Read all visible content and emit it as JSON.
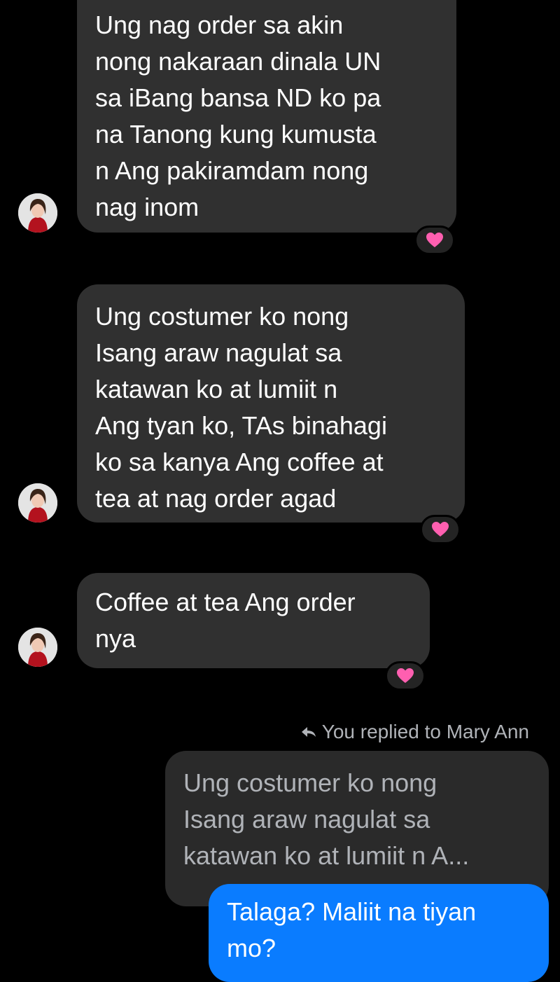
{
  "conversation": {
    "contact_name": "Mary Ann",
    "messages": [
      {
        "from": "Mary Ann",
        "text": "Ung nag order sa akin\nnong nakaraan dinala UN\nsa iBang bansa ND ko pa\nna Tanong kung kumusta\nn Ang pakiramdam nong\nnag inom",
        "reaction": "heart"
      },
      {
        "from": "Mary Ann",
        "text": "Ung costumer ko nong\nIsang araw nagulat sa\nkatawan ko at lumiit n\nAng tyan ko, TAs binahagi\nko sa kanya Ang coffee at\ntea at nag order agad",
        "reaction": "heart"
      },
      {
        "from": "Mary Ann",
        "text": "Coffee at tea Ang order\nnya",
        "reaction": "heart"
      }
    ],
    "reply": {
      "label": "You replied to Mary Ann",
      "quoted_text": "Ung costumer ko nong\nIsang araw nagulat sa\nkatawan ko at lumiit n A...",
      "text": "Talaga? Maliit na tiyan\nmo?"
    }
  },
  "colors": {
    "background": "#000000",
    "incoming_bubble": "#303030",
    "outgoing_bubble": "#0a7cff",
    "reaction_heart": "#ff5fb0",
    "meta_text": "#b0b3b8"
  },
  "icons": {
    "reaction": "heart-icon",
    "reply": "reply-arrow-icon"
  }
}
